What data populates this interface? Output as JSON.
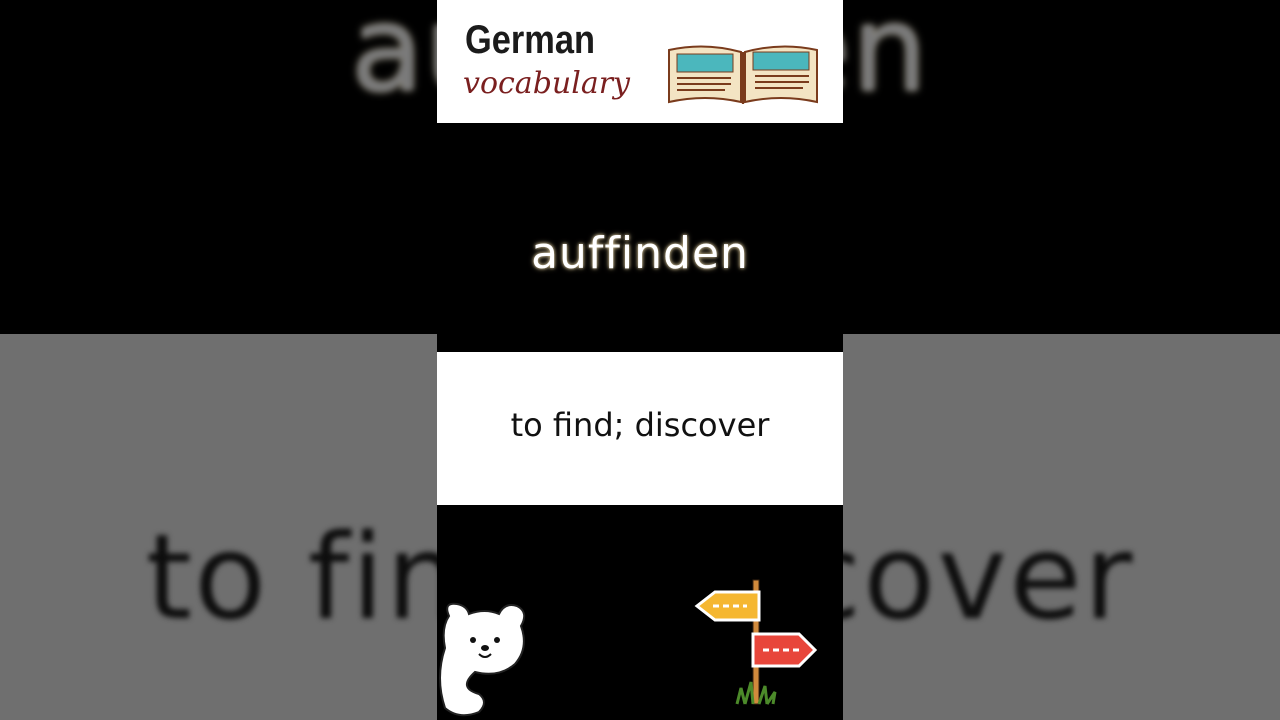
{
  "header": {
    "title": "German",
    "subtitle": "vocabulary",
    "book_icon": "open-book-icon"
  },
  "background": {
    "top_word": "auffinden",
    "bottom_word": "to find; discover"
  },
  "card": {
    "word": "auffinden",
    "meaning": "to find; discover"
  },
  "decorations": {
    "bear": "bear-icon",
    "signpost": "signpost-icon"
  },
  "colors": {
    "title": "#1b1b1b",
    "subtitle": "#7a1f1f",
    "book_pages": "#4bb7bd",
    "sign_yellow": "#f5b731",
    "sign_red": "#e8463b"
  }
}
